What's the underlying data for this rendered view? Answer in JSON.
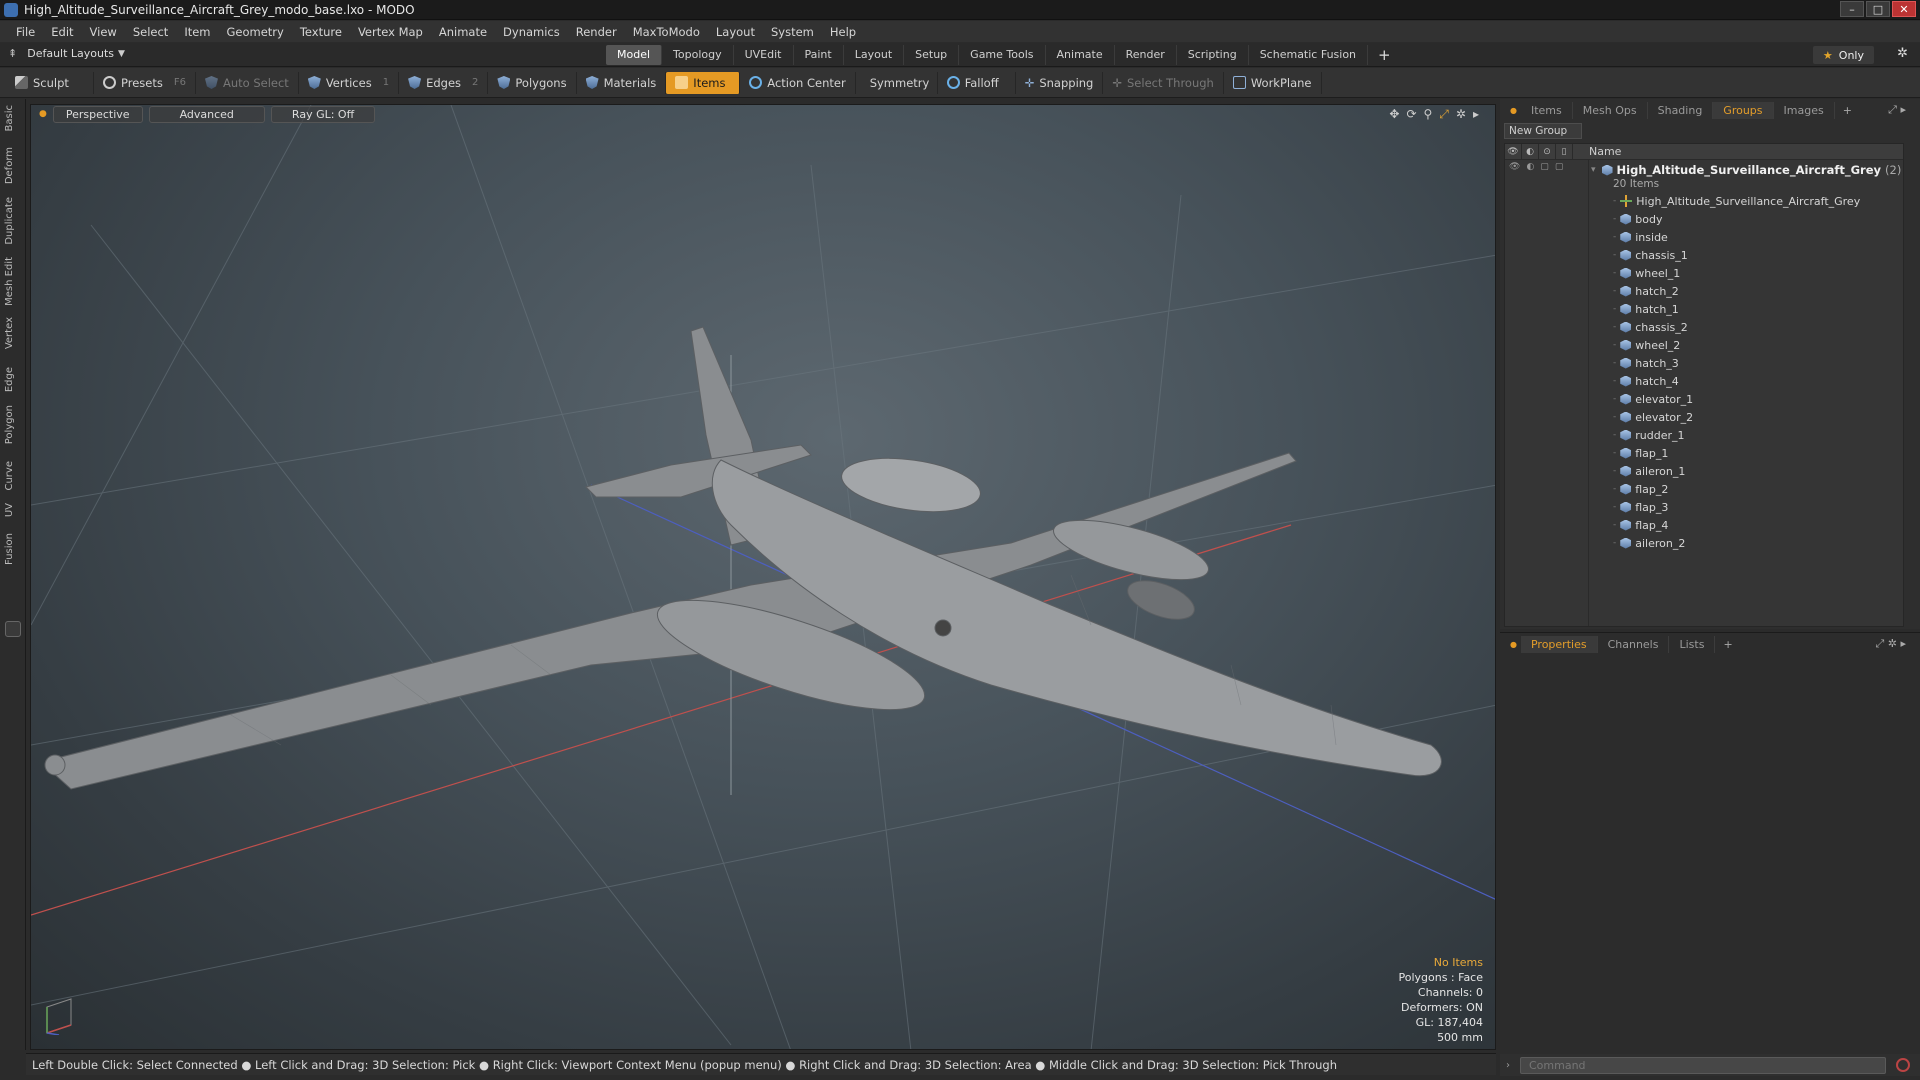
{
  "window": {
    "title": "High_Altitude_Surveillance_Aircraft_Grey_modo_base.lxo - MODO"
  },
  "menu": [
    "File",
    "Edit",
    "View",
    "Select",
    "Item",
    "Geometry",
    "Texture",
    "Vertex Map",
    "Animate",
    "Dynamics",
    "Render",
    "MaxToModo",
    "Layout",
    "System",
    "Help"
  ],
  "layout": {
    "selector": "Default Layouts",
    "tabs": [
      "Model",
      "Topology",
      "UVEdit",
      "Paint",
      "Layout",
      "Setup",
      "Game Tools",
      "Animate",
      "Render",
      "Scripting",
      "Schematic Fusion"
    ],
    "active_tab": "Model",
    "only_label": "Only"
  },
  "toolbar": {
    "sculpt": "Sculpt",
    "presets": "Presets",
    "presets_key": "F6",
    "auto_select": "Auto Select",
    "vertices": "Vertices",
    "vertices_key": "1",
    "edges": "Edges",
    "edges_key": "2",
    "polygons": "Polygons",
    "materials": "Materials",
    "items": "Items",
    "action_center": "Action Center",
    "symmetry": "Symmetry",
    "falloff": "Falloff",
    "snapping": "Snapping",
    "select_through": "Select Through",
    "workplane": "WorkPlane"
  },
  "left_tabs": [
    "Basic",
    "Deform",
    "Duplicate",
    "Mesh Edit",
    "Vertex",
    "Edge",
    "Polygon",
    "Curve",
    "UV",
    "Fusion"
  ],
  "viewport": {
    "perspective": "Perspective",
    "advanced": "Advanced",
    "raygl": "Ray GL: Off",
    "info": {
      "no_items": "No Items",
      "polygons": "Polygons : Face",
      "channels": "Channels: 0",
      "deformers": "Deformers: ON",
      "gl": "GL: 187,404",
      "scale": "500 mm"
    }
  },
  "status": "Left Double Click: Select Connected ● Left Click and Drag: 3D Selection: Pick ● Right Click: Viewport Context Menu (popup menu) ● Right Click and Drag: 3D Selection: Area ● Middle Click and Drag: 3D Selection: Pick Through",
  "panel": {
    "tabs": [
      "Items",
      "Mesh Ops",
      "Shading",
      "Groups",
      "Images"
    ],
    "active_tab": "Groups",
    "new_group": "New Group",
    "name_header": "Name",
    "group": {
      "name": "High_Altitude_Surveillance_Aircraft_Grey",
      "count": "(2)",
      "sub": "20 Items"
    },
    "items": [
      {
        "name": "High_Altitude_Surveillance_Aircraft_Grey",
        "type": "locator"
      },
      {
        "name": "body",
        "type": "mesh"
      },
      {
        "name": "inside",
        "type": "mesh"
      },
      {
        "name": "chassis_1",
        "type": "mesh"
      },
      {
        "name": "wheel_1",
        "type": "mesh"
      },
      {
        "name": "hatch_2",
        "type": "mesh"
      },
      {
        "name": "hatch_1",
        "type": "mesh"
      },
      {
        "name": "chassis_2",
        "type": "mesh"
      },
      {
        "name": "wheel_2",
        "type": "mesh"
      },
      {
        "name": "hatch_3",
        "type": "mesh"
      },
      {
        "name": "hatch_4",
        "type": "mesh"
      },
      {
        "name": "elevator_1",
        "type": "mesh"
      },
      {
        "name": "elevator_2",
        "type": "mesh"
      },
      {
        "name": "rudder_1",
        "type": "mesh"
      },
      {
        "name": "flap_1",
        "type": "mesh"
      },
      {
        "name": "aileron_1",
        "type": "mesh"
      },
      {
        "name": "flap_2",
        "type": "mesh"
      },
      {
        "name": "flap_3",
        "type": "mesh"
      },
      {
        "name": "flap_4",
        "type": "mesh"
      },
      {
        "name": "aileron_2",
        "type": "mesh"
      }
    ]
  },
  "props": {
    "tabs": [
      "Properties",
      "Channels",
      "Lists"
    ],
    "active_tab": "Properties"
  },
  "command": {
    "placeholder": "Command"
  },
  "colors": {
    "accent": "#e59a24",
    "background": "#2b2b2b",
    "viewport": "#47525a"
  }
}
